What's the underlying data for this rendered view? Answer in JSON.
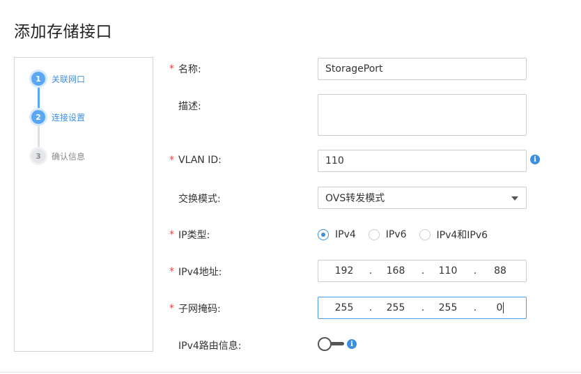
{
  "page": {
    "title": "添加存储接口"
  },
  "steps": [
    {
      "num": "1",
      "label": "关联网口",
      "state": "active"
    },
    {
      "num": "2",
      "label": "连接设置",
      "state": "active"
    },
    {
      "num": "3",
      "label": "确认信息",
      "state": "inactive"
    }
  ],
  "form": {
    "required_mark": "*",
    "name": {
      "label": "名称:",
      "value": "StoragePort"
    },
    "description": {
      "label": "描述:",
      "value": ""
    },
    "vlan_id": {
      "label": "VLAN ID:",
      "value": "110"
    },
    "switch_mode": {
      "label": "交换模式:",
      "value": "OVS转发模式"
    },
    "ip_type": {
      "label": "IP类型:",
      "options": [
        "IPv4",
        "IPv6",
        "IPv4和IPv6"
      ],
      "selected": "IPv4"
    },
    "ipv4_address": {
      "label": "IPv4地址:",
      "octets": [
        "192",
        "168",
        "110",
        "88"
      ]
    },
    "subnet_mask": {
      "label": "子网掩码:",
      "octets": [
        "255",
        "255",
        "255",
        "0"
      ]
    },
    "ipv4_route": {
      "label": "IPv4路由信息:",
      "enabled": false
    },
    "info_glyph": "i"
  },
  "colors": {
    "accent": "#3d8fe0",
    "required": "#e64545",
    "step_active": "#5aa8f5"
  }
}
